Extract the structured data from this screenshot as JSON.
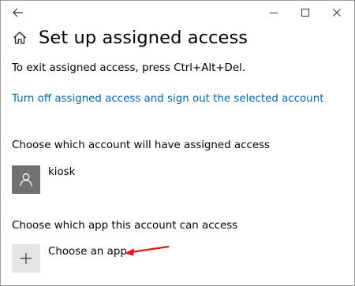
{
  "window": {
    "icons": {
      "back": "back-arrow-icon",
      "minimize": "minimize-icon",
      "maximize": "maximize-icon",
      "close": "close-icon"
    }
  },
  "header": {
    "icon": "home-icon",
    "title": "Set up assigned access"
  },
  "content": {
    "exit_instruction": "To exit assigned access, press Ctrl+Alt+Del.",
    "turn_off_link": "Turn off assigned access and sign out the selected account",
    "account_heading": "Choose which account will have assigned access",
    "account": {
      "icon": "user-avatar-icon",
      "name": "kiosk"
    },
    "app_heading": "Choose which app this account can access",
    "choose_app": {
      "icon": "plus-icon",
      "label": "Choose an app"
    }
  },
  "colors": {
    "link": "#0067b8",
    "avatar_bg": "#717171",
    "add_tile_bg": "#e5e5e5",
    "annotation_arrow": "#e8141b"
  }
}
